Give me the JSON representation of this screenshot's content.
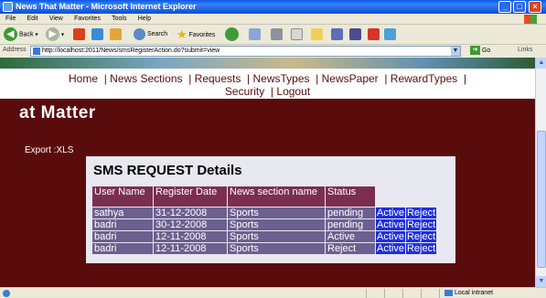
{
  "window": {
    "title": "News That Matter - Microsoft Internet Explorer",
    "controls": [
      "minimize",
      "maximize",
      "close"
    ]
  },
  "menu": [
    "File",
    "Edit",
    "View",
    "Favorites",
    "Tools",
    "Help"
  ],
  "toolbar": {
    "back_label": "Back",
    "search_label": "Search",
    "favorites_label": "Favorites"
  },
  "address": {
    "label": "Address",
    "url": "http://localhost:2011/News/smsRegisterAction.do?submit=view",
    "go_label": "Go",
    "links_label": "Links"
  },
  "page": {
    "nav_line1": [
      "Home",
      "News Sections",
      "Requests",
      "NewsTypes",
      "NewsPaper",
      "RewardTypes"
    ],
    "nav_line2": [
      "Security",
      "Logout"
    ],
    "heading": "at Matter",
    "export_label": "Export :XLS",
    "panel_title": "SMS REQUEST Details",
    "columns": [
      "User Name",
      "Register Date",
      "News section name",
      "Status"
    ],
    "rows": [
      {
        "user": "sathya",
        "date": "31-12-2008",
        "section": "Sports",
        "status": "pending",
        "active": "Active",
        "reject": "Reject"
      },
      {
        "user": "badri",
        "date": "30-12-2008",
        "section": "Sports",
        "status": "pending",
        "active": "Active",
        "reject": "Reject"
      },
      {
        "user": "badri",
        "date": "12-11-2008",
        "section": "Sports",
        "status": "Active",
        "active": "Active",
        "reject": "Reject"
      },
      {
        "user": "badri",
        "date": "12-11-2008",
        "section": "Sports",
        "status": "Reject",
        "active": "Active",
        "reject": "Reject"
      }
    ]
  },
  "status": {
    "zone": "Local intranet"
  },
  "colors": {
    "page_bg": "#5a0c0c",
    "header_cell": "#7b2e52",
    "row_cell": "#6b6090",
    "action_cell": "#1f2fe0"
  }
}
